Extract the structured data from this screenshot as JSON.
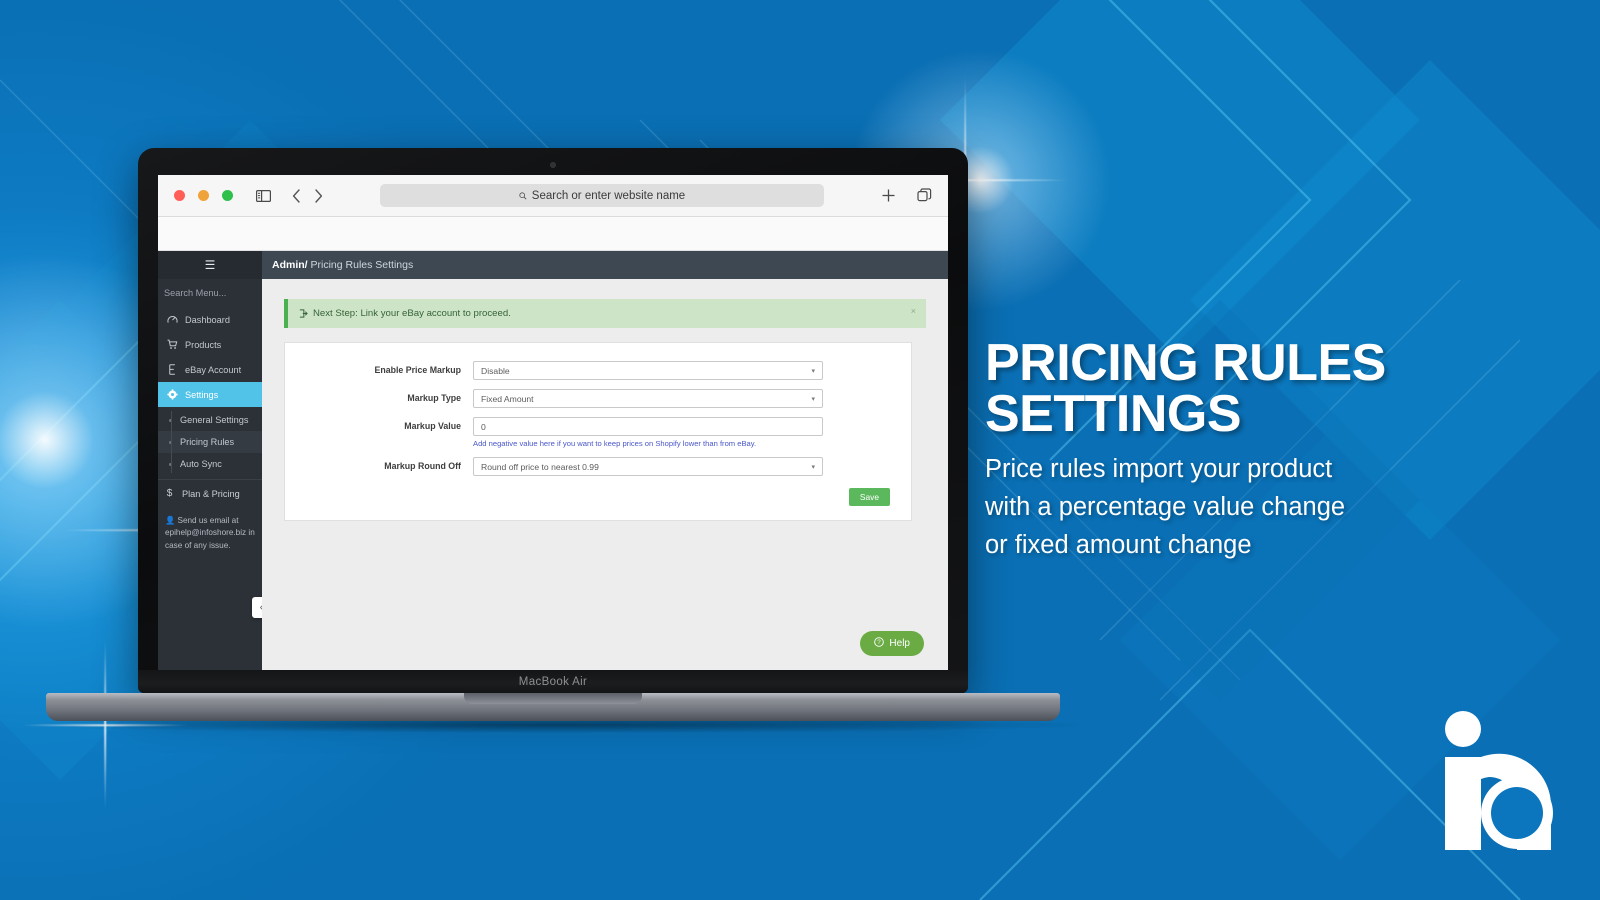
{
  "background": {
    "primary_color": "#0a74bd",
    "accent_color": "#1fa7e8"
  },
  "browser": {
    "traffic_lights": [
      "close-red",
      "minimize-yellow",
      "maximize-green"
    ],
    "sidebar_toggle_icon": "sidebar-icon",
    "back_icon": "chevron-left-icon",
    "forward_icon": "chevron-right-icon",
    "url_placeholder": "Search or enter website name",
    "search_icon": "search-icon",
    "new_tab_icon": "plus-icon",
    "tab_overview_icon": "copy-tabs-icon"
  },
  "device": {
    "model_label": "MacBook Air"
  },
  "sidebar": {
    "hamburger_icon": "hamburger-icon",
    "search_placeholder": "Search Menu...",
    "items": [
      {
        "label": "Dashboard",
        "icon": "speedometer-icon",
        "active": false
      },
      {
        "label": "Products",
        "icon": "cart-icon",
        "active": false
      },
      {
        "label": "eBay Account",
        "icon": "tag-icon",
        "active": false
      },
      {
        "label": "Settings",
        "icon": "gear-icon",
        "active": true
      }
    ],
    "sub_items": [
      {
        "label": "General Settings",
        "current": false
      },
      {
        "label": "Pricing Rules",
        "current": true
      },
      {
        "label": "Auto Sync",
        "current": false
      }
    ],
    "plan": {
      "label": "Plan & Pricing",
      "icon": "dollar-icon"
    },
    "note": {
      "icon": "user-icon",
      "text": "Send us email at epihelp@infoshore.biz in case of any issue."
    },
    "collapse_icon": "double-chevron-left-icon"
  },
  "header": {
    "breadcrumb_root": "Admin/",
    "breadcrumb_current": "Pricing Rules Settings"
  },
  "alert": {
    "icon": "sign-in-arrow-icon",
    "text": "Next Step: Link your eBay account to proceed.",
    "close_label": "×",
    "bg_color": "#cde5c6",
    "border_color": "#4caf50"
  },
  "form": {
    "fields": [
      {
        "label": "Enable Price Markup",
        "type": "select",
        "value": "Disable",
        "help": ""
      },
      {
        "label": "Markup Type",
        "type": "select",
        "value": "Fixed Amount",
        "help": ""
      },
      {
        "label": "Markup Value",
        "type": "text",
        "value": "0",
        "help": "Add negative value here if you want to keep prices on Shopify lower than from eBay."
      },
      {
        "label": "Markup Round Off",
        "type": "select",
        "value": "Round off price to nearest 0.99",
        "help": ""
      }
    ],
    "save_label": "Save",
    "save_color": "#5cb85c"
  },
  "help_widget": {
    "label": "Help",
    "icon": "question-circle-icon",
    "color": "#6aab44"
  },
  "promo": {
    "title_line1": "PRICING RULES",
    "title_line2": "SETTINGS",
    "subtitle_line1": "Price rules import your product",
    "subtitle_line2": "with a percentage value change",
    "subtitle_line3": "or fixed amount change"
  },
  "logo": {
    "name": "infoshore-logo",
    "alt": "ia monogram"
  }
}
